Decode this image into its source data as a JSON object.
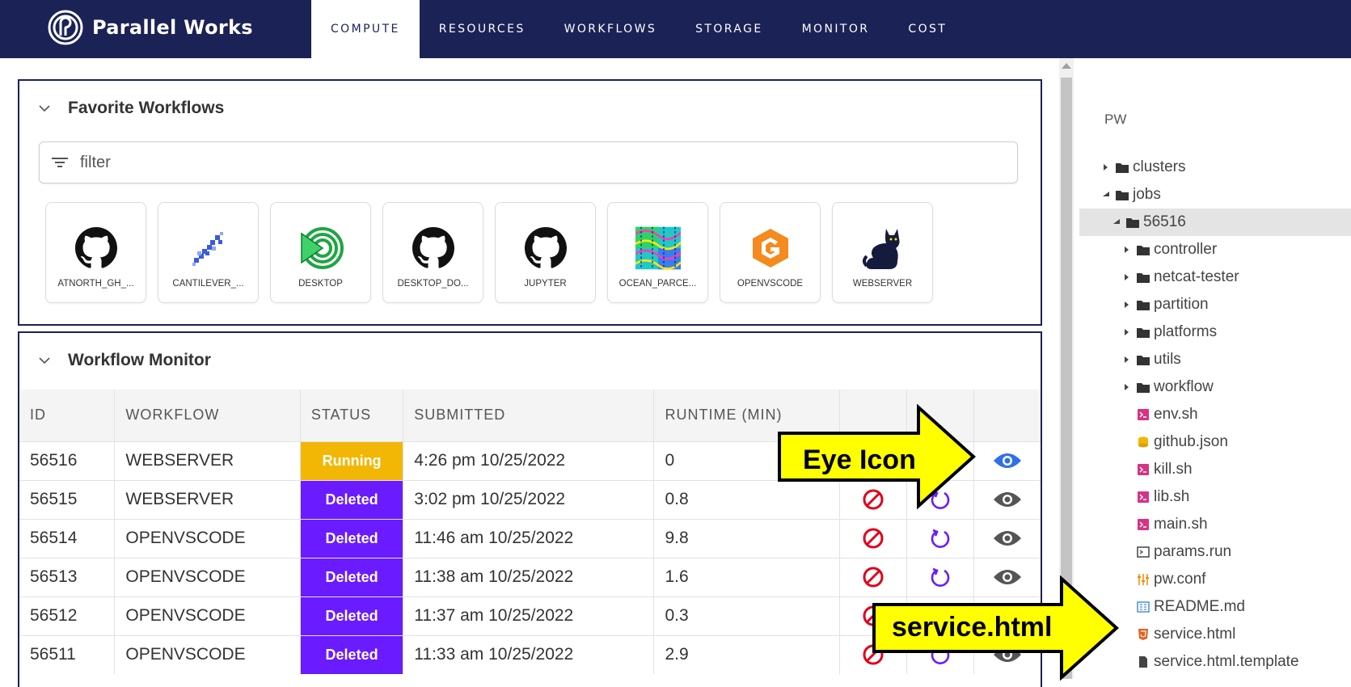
{
  "brand": {
    "name": "Parallel Works"
  },
  "nav": {
    "tabs": [
      {
        "label": "COMPUTE",
        "active": true
      },
      {
        "label": "RESOURCES",
        "active": false
      },
      {
        "label": "WORKFLOWS",
        "active": false
      },
      {
        "label": "STORAGE",
        "active": false
      },
      {
        "label": "MONITOR",
        "active": false
      },
      {
        "label": "COST",
        "active": false
      }
    ]
  },
  "favorites": {
    "title": "Favorite Workflows",
    "filter_placeholder": "filter",
    "cards": [
      {
        "label": "ATNORTH_GH_...",
        "icon": "github-icon"
      },
      {
        "label": "CANTILEVER_...",
        "icon": "cantilever-icon"
      },
      {
        "label": "DESKTOP",
        "icon": "desktop-icon"
      },
      {
        "label": "DESKTOP_DO...",
        "icon": "github-icon"
      },
      {
        "label": "JUPYTER",
        "icon": "github-icon"
      },
      {
        "label": "OCEAN_PARCE...",
        "icon": "ocean-parcels-icon"
      },
      {
        "label": "OPENVSCODE",
        "icon": "openvscode-icon"
      },
      {
        "label": "WEBSERVER",
        "icon": "cat-icon"
      }
    ]
  },
  "monitor": {
    "title": "Workflow Monitor",
    "columns": [
      "ID",
      "WORKFLOW",
      "STATUS",
      "SUBMITTED",
      "RUNTIME (MIN)"
    ],
    "rows": [
      {
        "id": "56516",
        "workflow": "WEBSERVER",
        "status": "Running",
        "submitted": "4:26 pm 10/25/2022",
        "runtime": "0"
      },
      {
        "id": "56515",
        "workflow": "WEBSERVER",
        "status": "Deleted",
        "submitted": "3:02 pm 10/25/2022",
        "runtime": "0.8"
      },
      {
        "id": "56514",
        "workflow": "OPENVSCODE",
        "status": "Deleted",
        "submitted": "11:46 am 10/25/2022",
        "runtime": "9.8"
      },
      {
        "id": "56513",
        "workflow": "OPENVSCODE",
        "status": "Deleted",
        "submitted": "11:38 am 10/25/2022",
        "runtime": "1.6"
      },
      {
        "id": "56512",
        "workflow": "OPENVSCODE",
        "status": "Deleted",
        "submitted": "11:37 am 10/25/2022",
        "runtime": "0.3"
      },
      {
        "id": "56511",
        "workflow": "OPENVSCODE",
        "status": "Deleted",
        "submitted": "11:33 am 10/25/2022",
        "runtime": "2.9"
      }
    ]
  },
  "colors": {
    "nav_bg": "#1b2255",
    "running": "#f2b705",
    "deleted": "#6a1bff",
    "delete_icon": "#e0001b",
    "restart_icon": "#6a1bff",
    "eye_active": "#2f6fea",
    "eye_inactive": "#555555",
    "callout_fill": "#ffff00"
  },
  "tree": {
    "root": "PW",
    "items": [
      {
        "label": "clusters",
        "type": "folder",
        "level": 0,
        "expanded": false,
        "selected": false
      },
      {
        "label": "jobs",
        "type": "folder",
        "level": 0,
        "expanded": true,
        "selected": false
      },
      {
        "label": "56516",
        "type": "folder",
        "level": 1,
        "expanded": true,
        "selected": true
      },
      {
        "label": "controller",
        "type": "folder",
        "level": 2,
        "expanded": false,
        "selected": false
      },
      {
        "label": "netcat-tester",
        "type": "folder",
        "level": 2,
        "expanded": false,
        "selected": false
      },
      {
        "label": "partition",
        "type": "folder",
        "level": 2,
        "expanded": false,
        "selected": false
      },
      {
        "label": "platforms",
        "type": "folder",
        "level": 2,
        "expanded": false,
        "selected": false
      },
      {
        "label": "utils",
        "type": "folder",
        "level": 2,
        "expanded": false,
        "selected": false
      },
      {
        "label": "workflow",
        "type": "folder",
        "level": 2,
        "expanded": false,
        "selected": false
      },
      {
        "label": "env.sh",
        "type": "shell",
        "level": 2,
        "selected": false
      },
      {
        "label": "github.json",
        "type": "json",
        "level": 2,
        "selected": false
      },
      {
        "label": "kill.sh",
        "type": "shell",
        "level": 2,
        "selected": false
      },
      {
        "label": "lib.sh",
        "type": "shell",
        "level": 2,
        "selected": false
      },
      {
        "label": "main.sh",
        "type": "shell",
        "level": 2,
        "selected": false
      },
      {
        "label": "params.run",
        "type": "run",
        "level": 2,
        "selected": false
      },
      {
        "label": "pw.conf",
        "type": "conf",
        "level": 2,
        "selected": false
      },
      {
        "label": "README.md",
        "type": "md",
        "level": 2,
        "selected": false
      },
      {
        "label": "service.html",
        "type": "html",
        "level": 2,
        "selected": false
      },
      {
        "label": "service.html.template",
        "type": "file",
        "level": 2,
        "selected": false
      }
    ]
  },
  "callouts": {
    "eye_icon": "Eye Icon",
    "service_html": "service.html"
  }
}
